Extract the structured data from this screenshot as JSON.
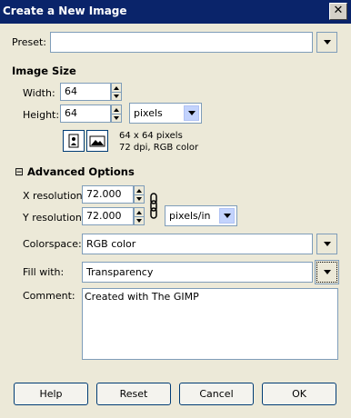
{
  "window": {
    "title": "Create a New Image",
    "close_glyph": "✕"
  },
  "preset": {
    "label": "Preset:",
    "value": ""
  },
  "image_size": {
    "heading": "Image Size",
    "width_label": "Width:",
    "width_value": "64",
    "height_label": "Height:",
    "height_value": "64",
    "unit": "pixels",
    "info_line1": "64 x 64 pixels",
    "info_line2": "72 dpi, RGB color"
  },
  "advanced": {
    "expander_glyph": "⊟",
    "heading": "Advanced Options",
    "x_res_label": "X resolution:",
    "x_res_value": "72.000",
    "y_res_label": "Y resolution:",
    "y_res_value": "72.000",
    "res_unit": "pixels/in",
    "colorspace_label": "Colorspace:",
    "colorspace_value": "RGB color",
    "fill_label": "Fill with:",
    "fill_value": "Transparency",
    "comment_label": "Comment:",
    "comment_value": "Created with The GIMP"
  },
  "buttons": {
    "help": "Help",
    "reset": "Reset",
    "cancel": "Cancel",
    "ok": "OK"
  }
}
